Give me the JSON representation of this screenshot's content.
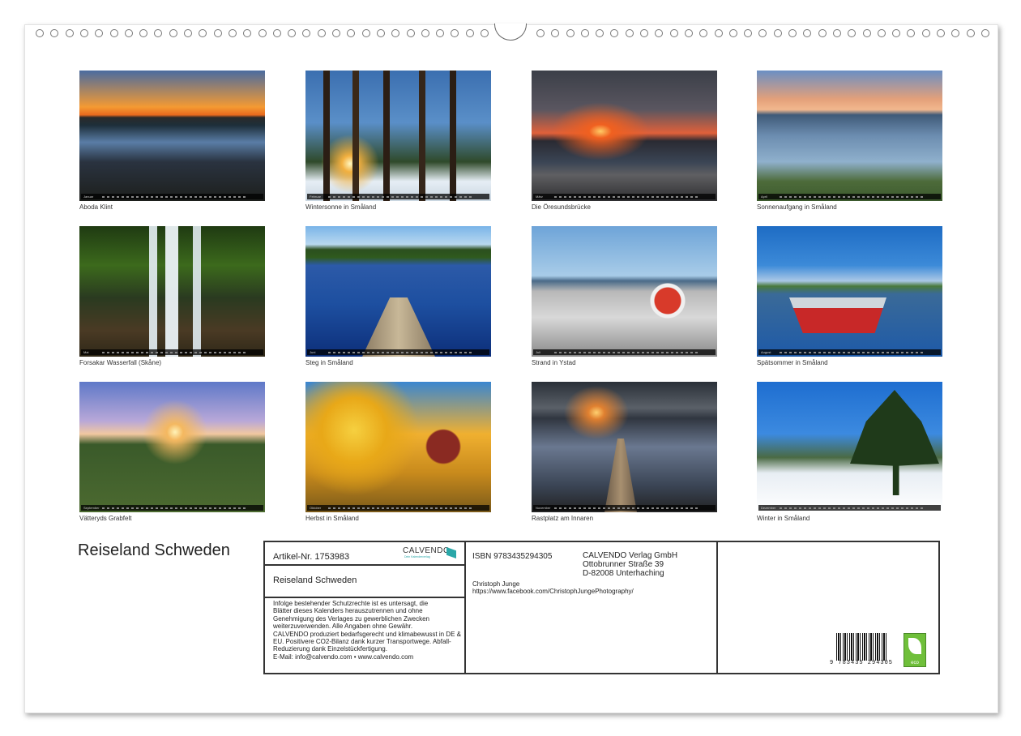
{
  "photos": [
    {
      "caption": "Aboda Klint",
      "month": "Januar"
    },
    {
      "caption": "Wintersonne in Småland",
      "month": "Februar"
    },
    {
      "caption": "Die Öresundsbrücke",
      "month": "März"
    },
    {
      "caption": "Sonnenaufgang in Småland",
      "month": "April"
    },
    {
      "caption": "Forsakar Wasserfall (Skåne)",
      "month": "Mai"
    },
    {
      "caption": "Steg in Småland",
      "month": "Juni"
    },
    {
      "caption": "Strand in Ystad",
      "month": "Juli"
    },
    {
      "caption": "Spätsommer in Småland",
      "month": "August"
    },
    {
      "caption": "Vätteryds Grabfelt",
      "month": "September"
    },
    {
      "caption": "Herbst in Småland",
      "month": "Oktober"
    },
    {
      "caption": "Rastplatz am Innaren",
      "month": "November"
    },
    {
      "caption": "Winter in Småland",
      "month": "Dezember"
    }
  ],
  "title": "Reiseland Schweden",
  "info": {
    "article": "Artikel-Nr. 1753983",
    "publisher_logo": "CALVENDO",
    "publisher_logo_sub": "Dein Kalenderverlag",
    "product_title": "Reiseland Schweden",
    "legal_lines": [
      "Infolge bestehender Schutzrechte ist es untersagt, die",
      "Blätter dieses Kalenders herauszutrennen und ohne",
      "Genehmigung des Verlages zu gewerblichen Zwecken",
      "weiterzuverwenden. Alle Angaben ohne Gewähr.",
      "CALVENDO produziert bedarfsgerecht und klimabewusst in DE &",
      "EU. Positivere CO2-Bilanz dank kurzer Transportwege. Abfall-",
      "Reduzierung dank Einzelstückfertigung.",
      "E-Mail: info@calvendo.com • www.calvendo.com"
    ],
    "isbn": "ISBN 9783435294305",
    "publisher": [
      "CALVENDO Verlag GmbH",
      "Ottobrunner Straße 39",
      "D-82008 Unterhaching"
    ],
    "author": "Christoph Junge",
    "author_url": "https://www.facebook.com/ChristophJungePhotography/",
    "barcode_number": "9 783435 294305",
    "eco_label": "eco"
  }
}
